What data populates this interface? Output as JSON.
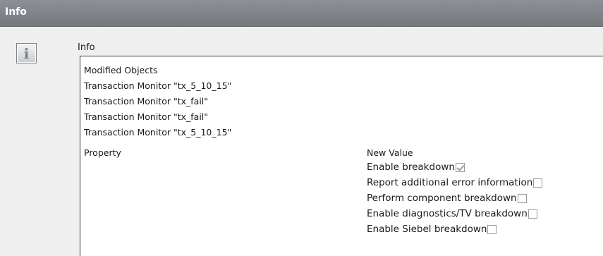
{
  "window": {
    "title": "Info"
  },
  "panel": {
    "icon": "info-icon",
    "label": "Info",
    "modified_objects_header": "Modified Objects",
    "modified_objects": [
      "Transaction Monitor \"tx_5_10_15\"",
      "Transaction Monitor \"tx_fail\"",
      "Transaction Monitor \"tx_fail\"",
      "Transaction Monitor \"tx_5_10_15\""
    ],
    "property_header": "Property",
    "new_value_header": "New Value",
    "options": [
      {
        "label": "Enable breakdown",
        "checked": true
      },
      {
        "label": "Report additional error information",
        "checked": false
      },
      {
        "label": "Perform component breakdown",
        "checked": false
      },
      {
        "label": "Enable diagnostics/TV breakdown",
        "checked": false
      },
      {
        "label": "Enable Siebel breakdown",
        "checked": false
      }
    ]
  }
}
